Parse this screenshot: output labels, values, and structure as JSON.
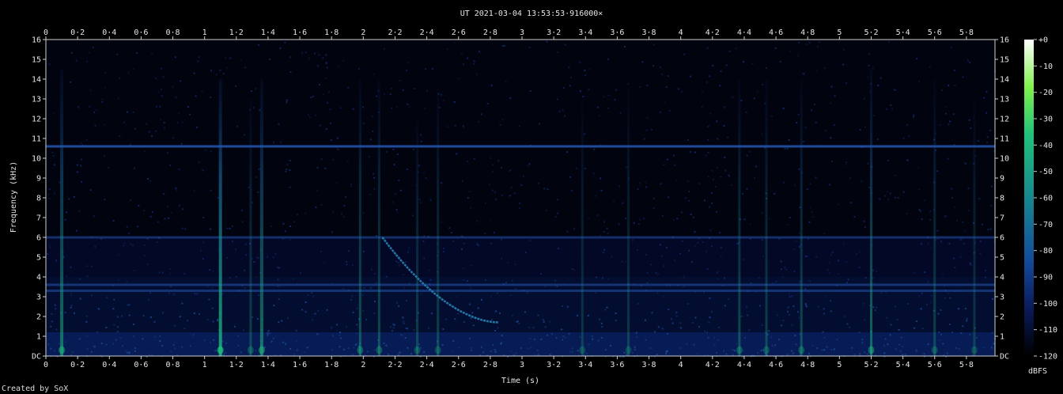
{
  "chart_data": {
    "type": "heatmap",
    "title": "UT 2021-03-04 13:53:53·916000×",
    "xlabel": "Time (s)",
    "ylabel": "Frequency (kHz)",
    "xlim": [
      0,
      5.98
    ],
    "ylim": [
      0,
      16
    ],
    "x_ticks": [
      "0",
      "0·2",
      "0·4",
      "0·6",
      "0·8",
      "1",
      "1·2",
      "1·4",
      "1·6",
      "1·8",
      "2",
      "2·2",
      "2·4",
      "2·6",
      "2·8",
      "3",
      "3·2",
      "3·4",
      "3·6",
      "3·8",
      "4",
      "4·2",
      "4·4",
      "4·6",
      "4·8",
      "5",
      "5·2",
      "5·4",
      "5·6",
      "5·8"
    ],
    "y_ticks": [
      "DC",
      "1",
      "2",
      "3",
      "4",
      "5",
      "6",
      "7",
      "8",
      "9",
      "10",
      "11",
      "12",
      "13",
      "14",
      "15",
      "16"
    ],
    "colorbar": {
      "label": "dBFS",
      "ticks": [
        "+0",
        "-10",
        "-20",
        "-30",
        "-40",
        "-50",
        "-60",
        "-70",
        "-80",
        "-90",
        "-100",
        "-110",
        "-120"
      ],
      "range": [
        -120,
        0
      ]
    },
    "features": {
      "horizontal_bands_khz": [
        10.6,
        6.0,
        3.6,
        3.3
      ],
      "vertical_bursts": [
        {
          "t": 0.1,
          "fmax": 14.5,
          "strength": 0.55
        },
        {
          "t": 1.1,
          "fmax": 14.0,
          "strength": 0.8
        },
        {
          "t": 1.36,
          "fmax": 14.0,
          "strength": 0.55
        },
        {
          "t": 1.29,
          "fmax": 13.0,
          "strength": 0.3
        },
        {
          "t": 1.98,
          "fmax": 14.0,
          "strength": 0.4
        },
        {
          "t": 2.1,
          "fmax": 14.0,
          "strength": 0.35
        },
        {
          "t": 2.34,
          "fmax": 12.0,
          "strength": 0.3
        },
        {
          "t": 2.47,
          "fmax": 13.5,
          "strength": 0.3
        },
        {
          "t": 3.38,
          "fmax": 13.0,
          "strength": 0.25
        },
        {
          "t": 3.67,
          "fmax": 13.5,
          "strength": 0.25
        },
        {
          "t": 4.37,
          "fmax": 14.0,
          "strength": 0.35
        },
        {
          "t": 4.54,
          "fmax": 14.0,
          "strength": 0.3
        },
        {
          "t": 4.76,
          "fmax": 14.0,
          "strength": 0.35
        },
        {
          "t": 5.2,
          "fmax": 14.5,
          "strength": 0.5
        },
        {
          "t": 5.6,
          "fmax": 14.0,
          "strength": 0.3
        },
        {
          "t": 5.85,
          "fmax": 13.0,
          "strength": 0.25
        }
      ],
      "whistler": {
        "t_start": 2.12,
        "t_end": 2.85,
        "f_start": 6.0,
        "f_end": 1.7
      }
    },
    "grid": false
  },
  "credit": "Created by SoX",
  "colors": {
    "background": "#000000",
    "colormap": [
      "#000000",
      "#0a1a5a",
      "#134a9a",
      "#17878f",
      "#1fc27a",
      "#7ff24a",
      "#ffffff"
    ]
  }
}
